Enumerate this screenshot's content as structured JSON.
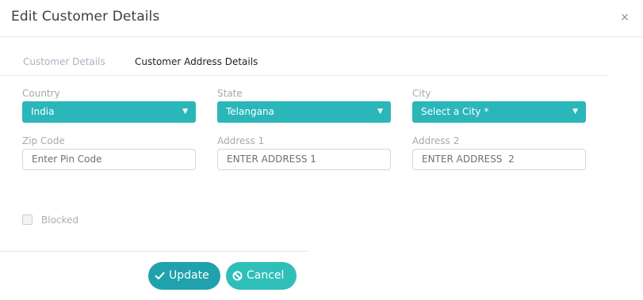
{
  "dialog": {
    "title": "Edit Customer Details",
    "close_glyph": "×"
  },
  "tabs": [
    {
      "label": "Customer Details"
    },
    {
      "label": "Customer Address Details"
    }
  ],
  "form": {
    "country": {
      "label": "Country",
      "value": "India"
    },
    "state": {
      "label": "State",
      "value": "Telangana"
    },
    "city": {
      "label": "City",
      "value": "Select a City *"
    },
    "zip": {
      "label": "Zip Code",
      "placeholder": "Enter Pin Code"
    },
    "address1": {
      "label": "Address 1",
      "placeholder": "ENTER ADDRESS 1"
    },
    "address2": {
      "label": "Address 2",
      "placeholder": "ENTER ADDRESS  2"
    },
    "blocked": {
      "label": "Blocked",
      "checked": false
    }
  },
  "actions": {
    "update_label": "Update",
    "cancel_label": "Cancel"
  },
  "icons": {
    "caret": "chevron-down-icon",
    "update": "check-icon",
    "cancel": "ban-icon",
    "close": "close-icon"
  },
  "colors": {
    "select_bg": "#2bb7b9",
    "update_bg": "#1fa2ad",
    "cancel_bg": "#2fbfb8"
  }
}
